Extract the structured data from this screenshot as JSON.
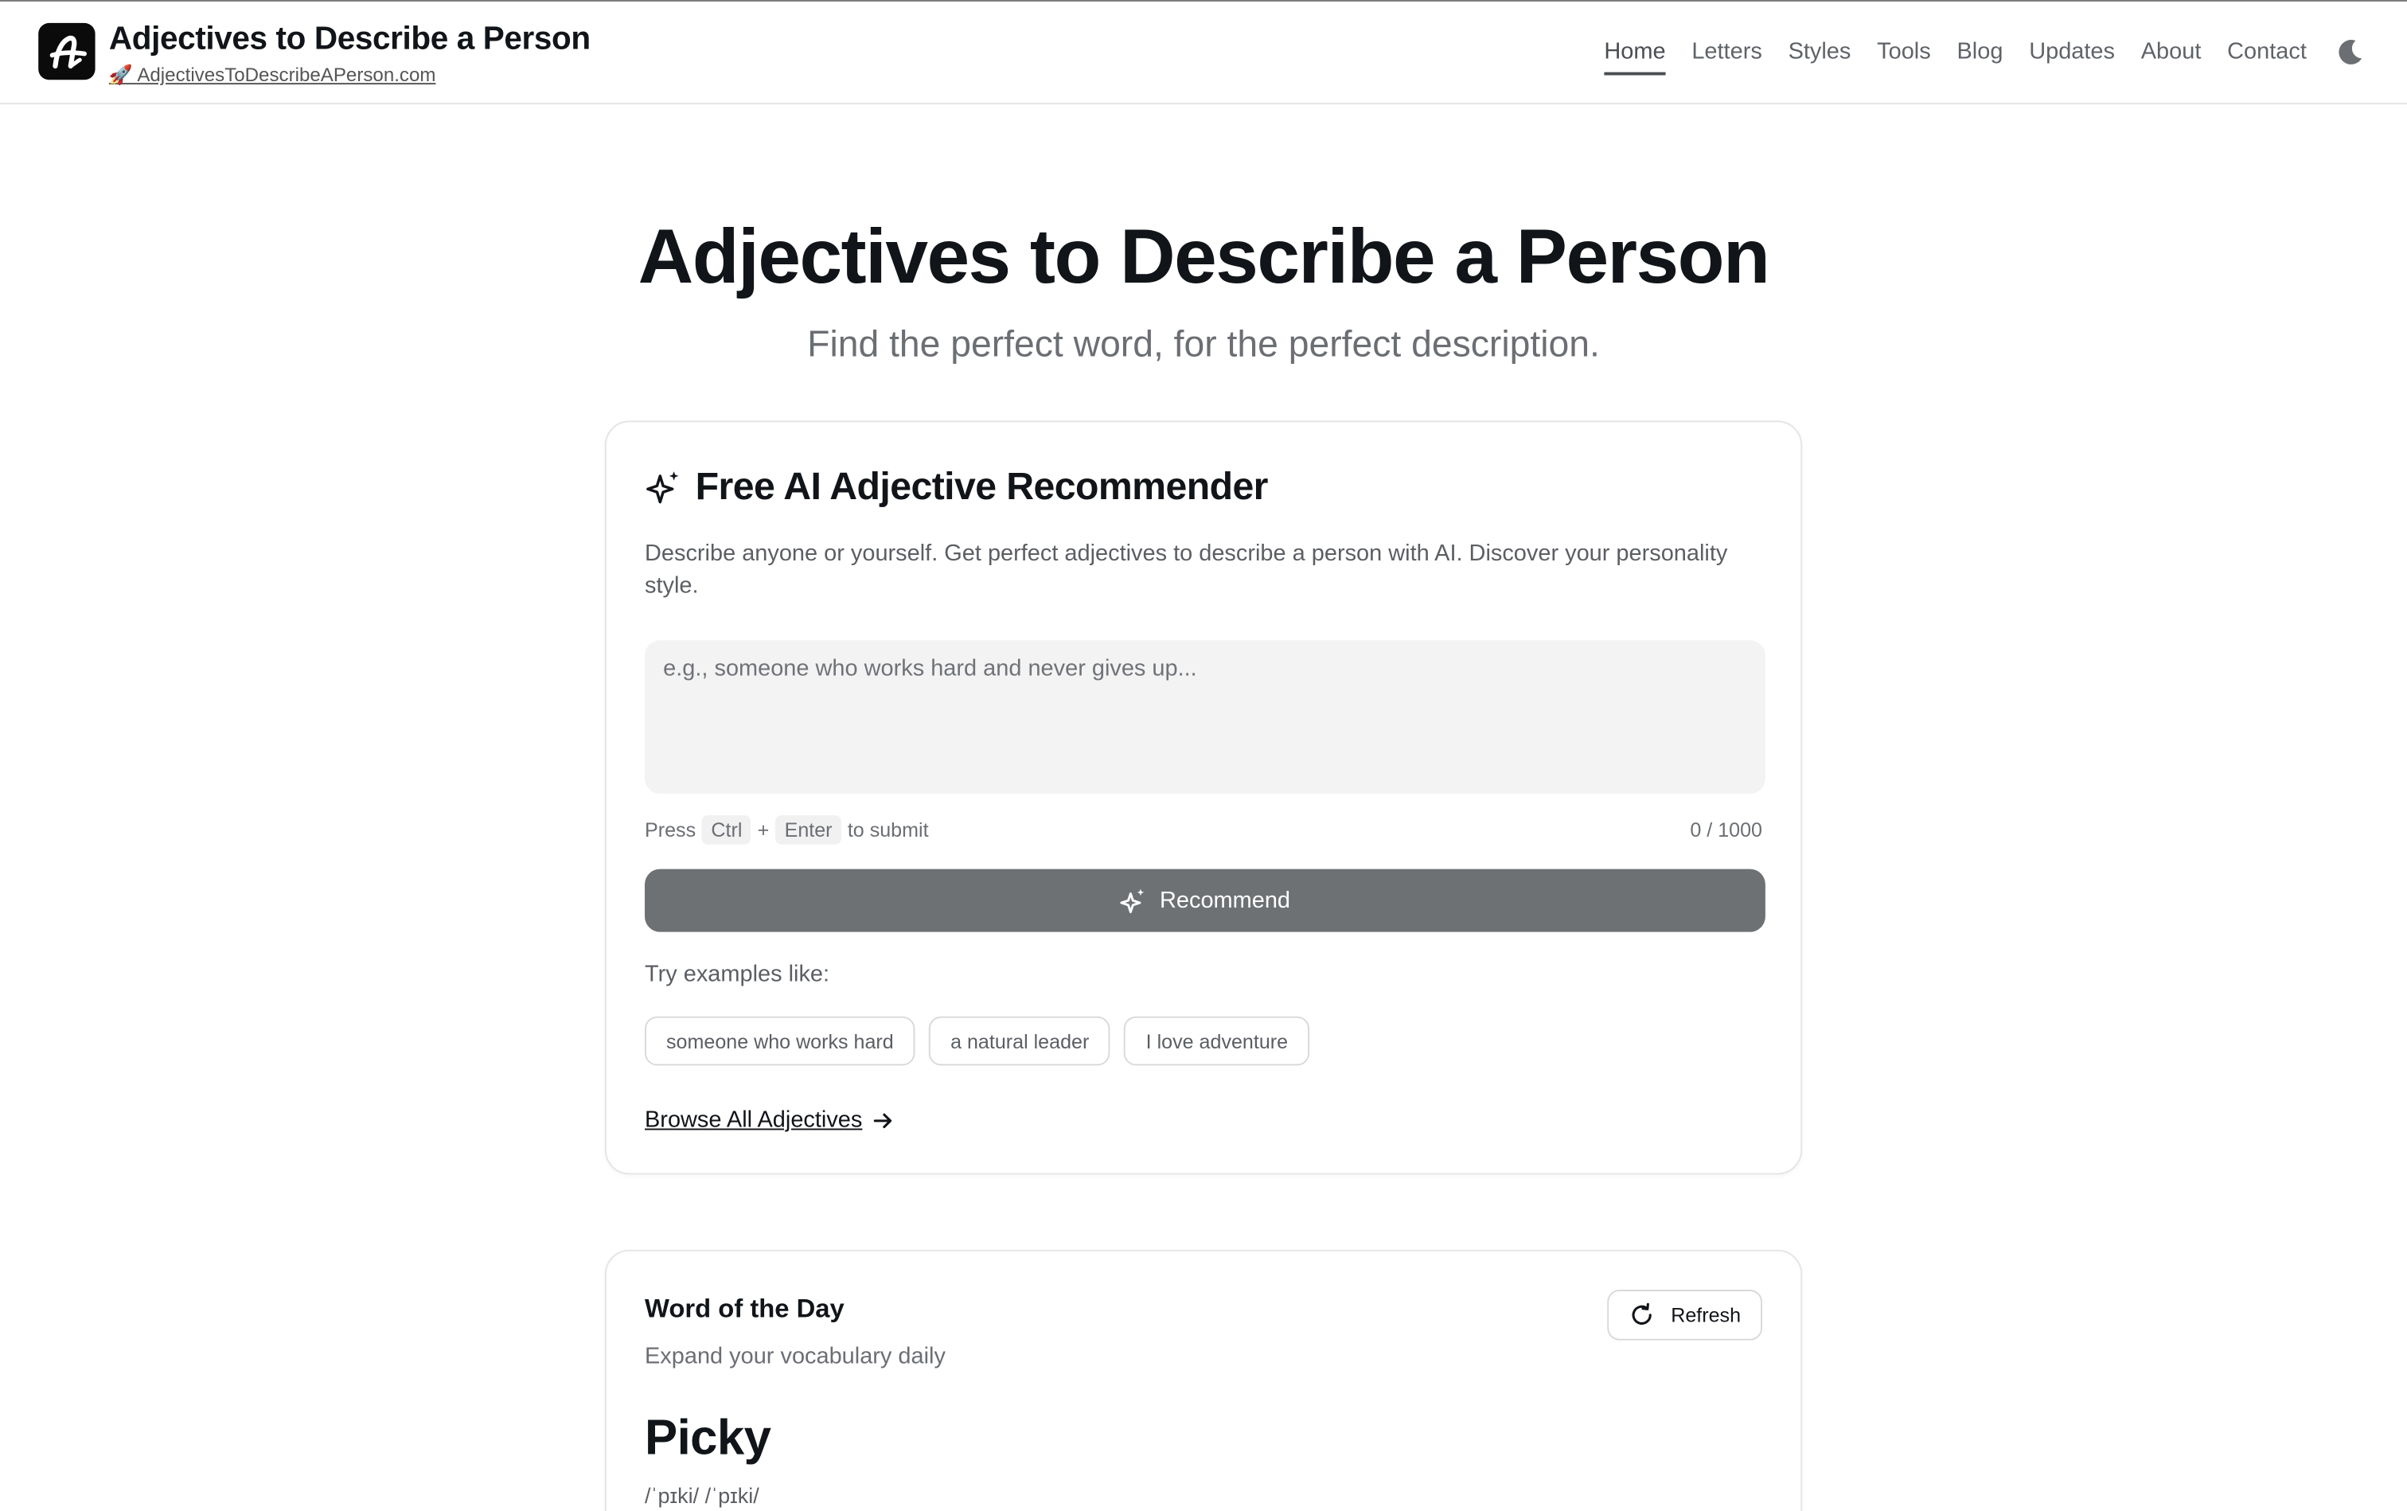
{
  "header": {
    "site_title": "Adjectives to Describe a Person",
    "site_url": "🚀 AdjectivesToDescribeAPerson.com",
    "nav": [
      "Home",
      "Letters",
      "Styles",
      "Tools",
      "Blog",
      "Updates",
      "About",
      "Contact"
    ],
    "active_nav": "Home",
    "theme_icon": "moon-icon"
  },
  "hero": {
    "title": "Adjectives to Describe a Person",
    "subtitle": "Find the perfect word, for the perfect description."
  },
  "ai_card": {
    "title": "Free AI Adjective Recommender",
    "description": "Describe anyone or yourself. Get perfect adjectives to describe a person with AI. Discover your personality style.",
    "input_placeholder": "e.g., someone who works hard and never gives up...",
    "input_value": "",
    "hint_press": "Press",
    "hint_key1": "Ctrl",
    "hint_plus": "+",
    "hint_key2": "Enter",
    "hint_suffix": "to submit",
    "counter": "0 / 1000",
    "button_label": "Recommend",
    "examples_label": "Try examples like:",
    "examples": [
      "someone who works hard",
      "a natural leader",
      "I love adventure"
    ],
    "browse_label": "Browse All Adjectives"
  },
  "word_of_day": {
    "title": "Word of the Day",
    "subtitle": "Expand your vocabulary daily",
    "refresh_label": "Refresh",
    "word": "Picky",
    "pronunciation": "/ˈpɪki/  /ˈpɪki/"
  },
  "colors": {
    "text": "#111418",
    "muted": "#6b6e73",
    "button_bg": "#6e7174",
    "input_bg": "#f3f3f3"
  }
}
